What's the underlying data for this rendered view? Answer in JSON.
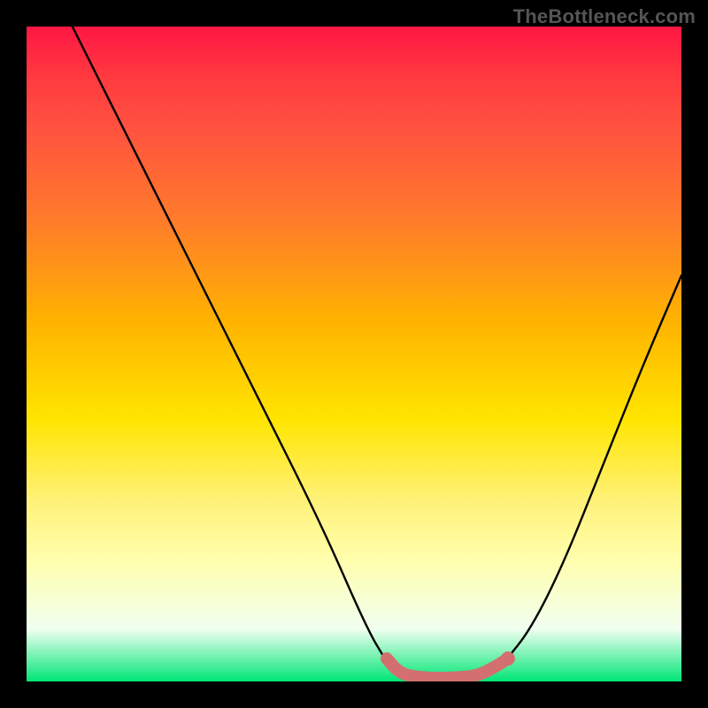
{
  "watermark": "TheBottleneck.com",
  "chart_data": {
    "type": "line",
    "title": "",
    "xlabel": "",
    "ylabel": "",
    "xlim": [
      0,
      100
    ],
    "ylim": [
      0,
      100
    ],
    "grid": false,
    "legend": false,
    "series": [
      {
        "name": "curve-left",
        "points": [
          {
            "x": 7,
            "y": 100
          },
          {
            "x": 16,
            "y": 82
          },
          {
            "x": 25,
            "y": 64
          },
          {
            "x": 35,
            "y": 44
          },
          {
            "x": 45,
            "y": 24
          },
          {
            "x": 52,
            "y": 8
          },
          {
            "x": 55,
            "y": 3
          }
        ]
      },
      {
        "name": "curve-right",
        "points": [
          {
            "x": 73,
            "y": 3
          },
          {
            "x": 77,
            "y": 8
          },
          {
            "x": 82,
            "y": 18
          },
          {
            "x": 88,
            "y": 33
          },
          {
            "x": 94,
            "y": 48
          },
          {
            "x": 100,
            "y": 62
          }
        ]
      }
    ],
    "highlight_band": {
      "name": "optimal-region",
      "color": "#d36f6f",
      "points": [
        {
          "x": 55,
          "y": 3.5
        },
        {
          "x": 57,
          "y": 1.2
        },
        {
          "x": 60,
          "y": 0.6
        },
        {
          "x": 63,
          "y": 0.5
        },
        {
          "x": 66,
          "y": 0.6
        },
        {
          "x": 69,
          "y": 0.9
        },
        {
          "x": 72,
          "y": 2.5
        },
        {
          "x": 73.5,
          "y": 3.5
        }
      ]
    }
  }
}
